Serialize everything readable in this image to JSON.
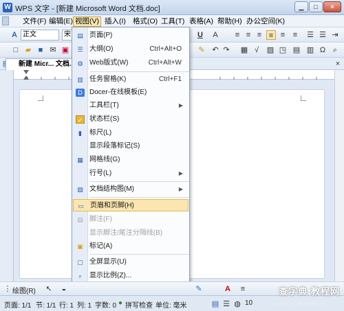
{
  "window": {
    "title": "WPS 文字 - [新建 Microsoft Word 文档.doc]",
    "app_icon": "W",
    "btn_min": "▁",
    "btn_max": "□",
    "btn_close": "✕"
  },
  "menubar": {
    "items": [
      "文件(F)",
      "编辑(E)",
      "视图(V)",
      "插入(I)",
      "格式(O)",
      "工具(T)",
      "表格(A)",
      "帮助(H)",
      "办公空间(K)"
    ],
    "active": "视图(V)"
  },
  "format_toolbar": {
    "style_value": "正文",
    "font_value": "宋"
  },
  "doc_tab": {
    "label": "新建 Micr... 文档.d"
  },
  "view_menu": {
    "items": [
      {
        "label": "页面(P)",
        "shortcut": "",
        "submenu": false,
        "icon": "page-view-icon",
        "state": "normal"
      },
      {
        "label": "大纲(O)",
        "shortcut": "Ctrl+Alt+O",
        "submenu": false,
        "icon": "outline-icon",
        "state": "normal"
      },
      {
        "label": "Web版式(W)",
        "shortcut": "Ctrl+Alt+W",
        "submenu": false,
        "icon": "web-layout-icon",
        "state": "normal"
      },
      {
        "label": "任务窗格(K)",
        "shortcut": "Ctrl+F1",
        "submenu": false,
        "icon": "task-pane-icon",
        "state": "normal"
      },
      {
        "label": "Docer-在线模板(E)",
        "shortcut": "",
        "submenu": false,
        "icon": "docer-icon",
        "state": "normal"
      },
      {
        "label": "工具栏(T)",
        "shortcut": "",
        "submenu": true,
        "icon": "",
        "state": "normal"
      },
      {
        "label": "状态栏(S)",
        "shortcut": "",
        "submenu": false,
        "icon": "checkmark-icon",
        "state": "normal"
      },
      {
        "label": "标尺(L)",
        "shortcut": "",
        "submenu": false,
        "icon": "ruler-icon",
        "state": "normal"
      },
      {
        "label": "显示段落标记(S)",
        "shortcut": "",
        "submenu": false,
        "icon": "",
        "state": "normal"
      },
      {
        "label": "网格线(G)",
        "shortcut": "",
        "submenu": false,
        "icon": "gridlines-icon",
        "state": "normal"
      },
      {
        "label": "行号(L)",
        "shortcut": "",
        "submenu": true,
        "icon": "",
        "state": "normal"
      },
      {
        "label": "文档结构图(M)",
        "shortcut": "",
        "submenu": true,
        "icon": "document-map-icon",
        "state": "normal"
      },
      {
        "label": "页眉和页脚(H)",
        "shortcut": "",
        "submenu": false,
        "icon": "header-footer-icon",
        "state": "hover"
      },
      {
        "label": "脚注(F)",
        "shortcut": "",
        "submenu": false,
        "icon": "footnote-icon",
        "state": "disabled"
      },
      {
        "label": "显示脚注/尾注分隔线(B)",
        "shortcut": "",
        "submenu": false,
        "icon": "",
        "state": "disabled"
      },
      {
        "label": "标记(A)",
        "shortcut": "",
        "submenu": false,
        "icon": "markup-icon",
        "state": "normal"
      },
      {
        "label": "全屏显示(U)",
        "shortcut": "",
        "submenu": false,
        "icon": "fullscreen-icon",
        "state": "normal"
      },
      {
        "label": "显示比例(Z)...",
        "shortcut": "",
        "submenu": false,
        "icon": "zoom-icon",
        "state": "normal"
      }
    ]
  },
  "drawbar": {
    "draw_label": "绘图(R)"
  },
  "statusbar": {
    "page": "页面: 1/1",
    "section": "节: 1/1",
    "row": "行: 1",
    "col": "列: 1",
    "words": "字数: 0",
    "spellcheck": "拼写检查",
    "unit": "单位: 毫米",
    "zoom": "10"
  },
  "watermark": {
    "brand": "查字典 教程网",
    "url": "jiaocheng.chazidian.com"
  },
  "colors": {
    "menu_hover": "#fbe6b0",
    "titlebar": "#c2d5ed",
    "accent_blue": "#2d62b7"
  }
}
